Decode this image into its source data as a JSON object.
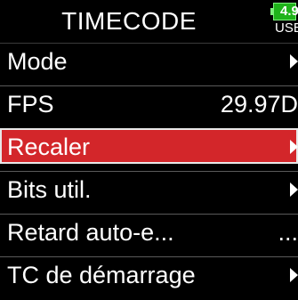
{
  "header": {
    "title": "TIMECODE",
    "battery_level": "4.9",
    "battery_source": "USB"
  },
  "menu": {
    "items": [
      {
        "label": "Mode",
        "value": "",
        "arrow": true
      },
      {
        "label": "FPS",
        "value": "29.97D",
        "arrow": false
      },
      {
        "label": "Recaler",
        "value": "",
        "arrow": true,
        "selected": true
      },
      {
        "label": "Bits util.",
        "value": "",
        "arrow": true
      },
      {
        "label": "Retard auto-e...",
        "value": "...",
        "arrow": false
      },
      {
        "label": "TC de démarrage",
        "value": "",
        "arrow": true
      }
    ]
  },
  "colors": {
    "background": "#000000",
    "selection": "#d3262a",
    "battery": "#1fb31a",
    "text": "#ffffff"
  },
  "icons": {
    "arrow": "chevron-right-icon",
    "battery": "battery-icon"
  }
}
